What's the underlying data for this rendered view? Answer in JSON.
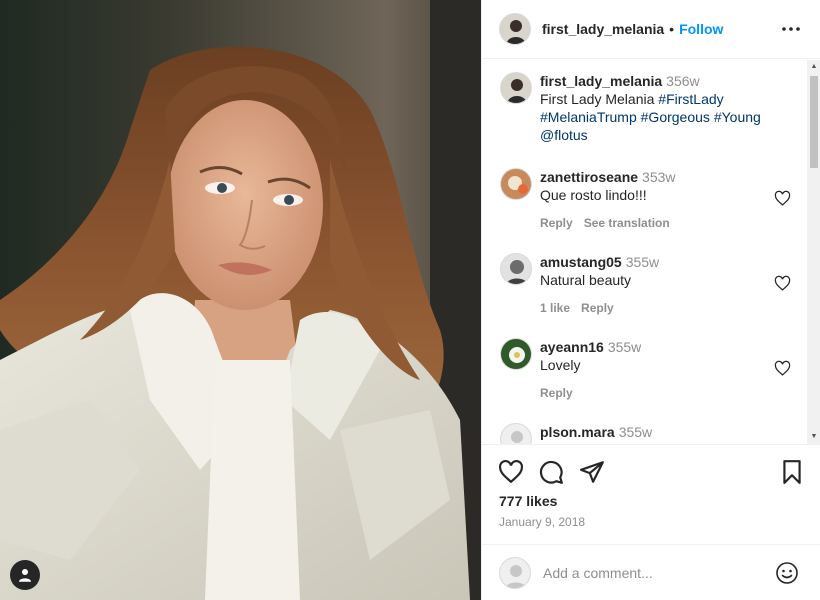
{
  "post": {
    "username": "first_lady_melania",
    "follow_label": "Follow",
    "separator": "•",
    "likes": "777 likes",
    "date": "January 9, 2018"
  },
  "caption": {
    "username": "first_lady_melania",
    "time": "356w",
    "text_prefix": "First Lady Melania ",
    "tags": [
      "#FirstLady",
      "#MelaniaTrump",
      "#Gorgeous",
      "#Young",
      "@flotus"
    ]
  },
  "comments": [
    {
      "username": "zanettiroseane",
      "time": "353w",
      "text": "Que rosto lindo!!!",
      "reply": "Reply",
      "translate": "See translation"
    },
    {
      "username": "amustang05",
      "time": "355w",
      "text": "Natural beauty",
      "likes": "1 like",
      "reply": "Reply"
    },
    {
      "username": "ayeann16",
      "time": "355w",
      "text": "Lovely",
      "reply": "Reply"
    },
    {
      "username": "plson.mara",
      "time": "355w"
    }
  ],
  "add_comment": {
    "placeholder": "Add a comment..."
  },
  "icons": {
    "more": "more-horizontal-icon",
    "like": "heart-icon",
    "comment": "comment-icon",
    "share": "paper-plane-icon",
    "save": "bookmark-icon",
    "emoji": "smiley-icon",
    "user_tags": "user-tags-icon"
  },
  "colors": {
    "accent": "#0095f6",
    "tag": "#00376b",
    "muted": "#8e8e8e",
    "text": "#262626"
  }
}
